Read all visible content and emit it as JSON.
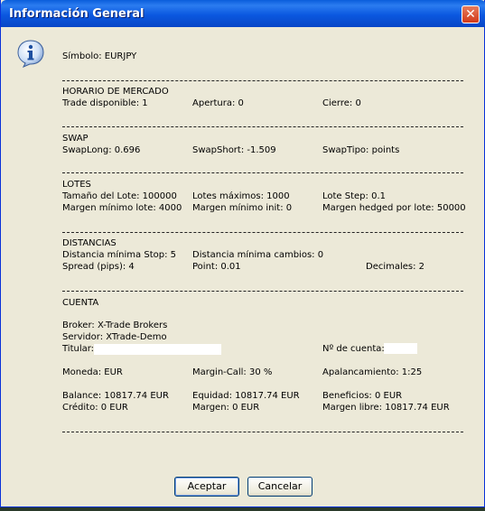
{
  "window": {
    "title": "Información General",
    "close_symbol": "✕"
  },
  "symbol": "Símbolo: EURJPY",
  "market_hours": {
    "heading": "HORARIO DE MERCADO",
    "trade_available": "Trade disponible: 1",
    "open": "Apertura: 0",
    "close": "Cierre: 0"
  },
  "swap": {
    "heading": "SWAP",
    "long": "SwapLong: 0.696",
    "short": "SwapShort: -1.509",
    "type": "SwapTipo:  points"
  },
  "lots": {
    "heading": "LOTES",
    "lot_size": "Tamaño del Lote: 100000",
    "max_lots": "Lotes máximos: 1000",
    "lot_step": "Lote Step: 0.1",
    "min_margin_lot": "Margen mínimo lote: 4000",
    "min_margin_init": "Margen mínimo init: 0",
    "hedged_margin": "Margen hedged por lote: 50000"
  },
  "distances": {
    "heading": "DISTANCIAS",
    "min_stop": "Distancia mínima Stop: 5",
    "min_change": "Distancia mínima cambios: 0",
    "spread": "Spread (pips): 4",
    "point": "Point: 0.01",
    "decimals": "Decimales: 2"
  },
  "account": {
    "heading": "CUENTA",
    "broker": "Broker: X-Trade Brokers",
    "server": "Servidor: XTrade-Demo",
    "holder_label": "Titular:",
    "account_no_label": "Nº de cuenta:",
    "currency": "Moneda: EUR",
    "margin_call": "Margin-Call: 30 %",
    "leverage": "Apalancamiento: 1:25",
    "balance": "Balance: 10817.74 EUR",
    "equity": "Equidad: 10817.74 EUR",
    "profit": "Beneficios: 0 EUR",
    "credit": "Crédito: 0 EUR",
    "margin": "Margen: 0 EUR",
    "free_margin": "Margen libre: 10817.74 EUR"
  },
  "buttons": {
    "accept": "Aceptar",
    "cancel": "Cancelar"
  },
  "colors": {
    "title_bar": "#0a5ddb",
    "dialog_bg": "#ece9d8",
    "close_btn": "#d23a1a"
  },
  "icons": {
    "info": "info-icon",
    "close": "close-icon"
  }
}
